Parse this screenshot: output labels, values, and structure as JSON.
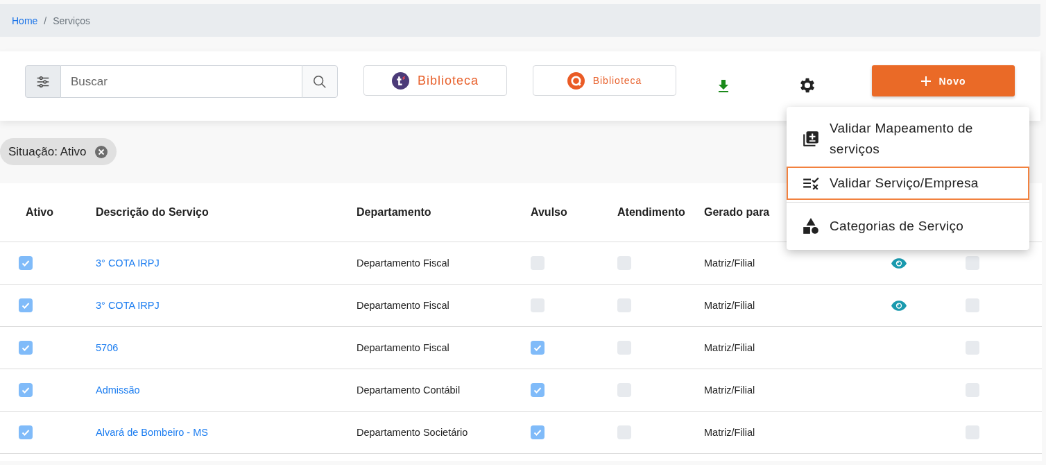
{
  "breadcrumb": [
    {
      "label": "Home",
      "current": false
    },
    {
      "separator": "/",
      "label": "Serviços",
      "current": true
    }
  ],
  "toolbar": {
    "search": {
      "placeholder": "Buscar"
    },
    "library_buttons": [
      {
        "kind": "t",
        "label": "Biblioteca"
      },
      {
        "kind": "q",
        "label": "Biblioteca"
      }
    ],
    "new_button": {
      "label": "Novo"
    }
  },
  "filters": [
    {
      "label": "Situação: Ativo"
    }
  ],
  "table": {
    "columns": [
      "Ativo",
      "Descrição do Serviço",
      "Departamento",
      "Avulso",
      "Atendimento",
      "Gerado para"
    ],
    "rows": [
      {
        "ativo": true,
        "description": "3° COTA IRPJ",
        "department": "Departamento Fiscal",
        "avulso": false,
        "atendimento": false,
        "generated_for": "Matriz/Filial",
        "eye": true,
        "column_8": false
      },
      {
        "ativo": true,
        "description": "3° COTA IRPJ",
        "department": "Departamento Fiscal",
        "avulso": false,
        "atendimento": false,
        "generated_for": "Matriz/Filial",
        "eye": true,
        "column_8": false
      },
      {
        "ativo": true,
        "description": "5706",
        "department": "Departamento Fiscal",
        "avulso": true,
        "atendimento": false,
        "generated_for": "Matriz/Filial",
        "eye": false,
        "column_8": false
      },
      {
        "ativo": true,
        "description": "Admissão",
        "department": "Departamento Contábil",
        "avulso": true,
        "atendimento": false,
        "generated_for": "Matriz/Filial",
        "eye": false,
        "column_8": false
      },
      {
        "ativo": true,
        "description": "Alvará de Bombeiro - MS",
        "department": "Departamento Societário",
        "avulso": true,
        "atendimento": false,
        "generated_for": "Matriz/Filial",
        "eye": false,
        "column_8": false
      }
    ]
  },
  "settings_menu": [
    {
      "kind": "document",
      "label": "Validar Mapeamento de serviços",
      "selected": false
    },
    {
      "kind": "checklist",
      "label": "Validar Serviço/Empresa",
      "selected": true
    },
    {
      "kind": "shapes",
      "label": "Categorias de Serviço",
      "selected": false
    }
  ]
}
